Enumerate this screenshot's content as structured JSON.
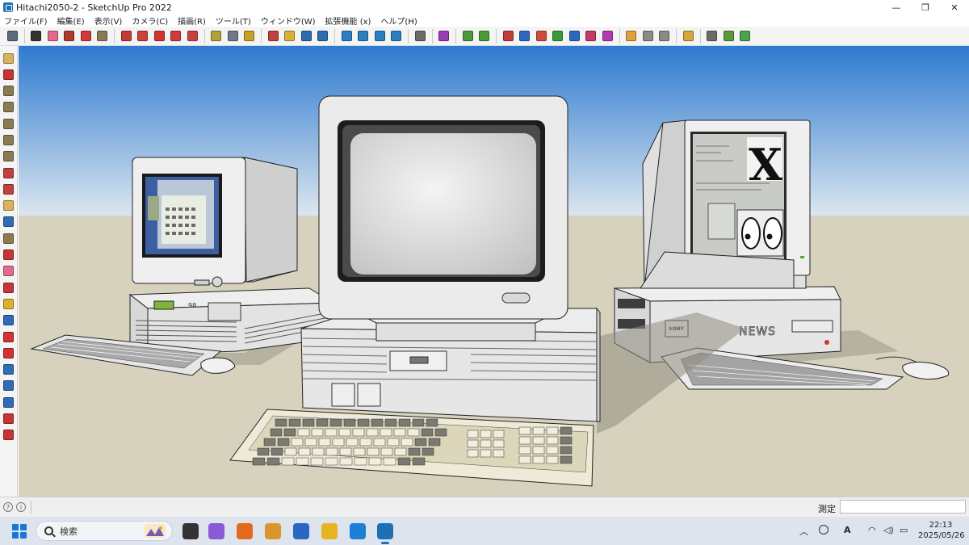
{
  "window": {
    "title": "Hitachi2050-2 - SketchUp Pro 2022",
    "controls": [
      "—",
      "❐",
      "✕"
    ]
  },
  "menu": [
    "ファイル(F)",
    "編集(E)",
    "表示(V)",
    "カメラ(C)",
    "描画(R)",
    "ツール(T)",
    "ウィンドウ(W)",
    "拡張機能 (x)",
    "ヘルプ(H)"
  ],
  "toolbar": {
    "groups": [
      {
        "icons": [
          {
            "name": "zoom-icon",
            "color": "#5a6b7d"
          }
        ]
      },
      {
        "icons": [
          {
            "name": "select-icon",
            "color": "#333333"
          },
          {
            "name": "eraser-icon",
            "color": "#e46a8c"
          },
          {
            "name": "pencil-line-icon",
            "color": "#b0392e"
          },
          {
            "name": "arc-icon",
            "color": "#d3393c"
          },
          {
            "name": "shape-icon",
            "color": "#8b7b52"
          }
        ]
      },
      {
        "icons": [
          {
            "name": "push-pull-icon",
            "color": "#c43a3a"
          },
          {
            "name": "follow-me-icon",
            "color": "#c8433c"
          },
          {
            "name": "move-icon",
            "color": "#d23232"
          },
          {
            "name": "rotate-icon",
            "color": "#d23b3b"
          },
          {
            "name": "scale-icon",
            "color": "#c74343"
          }
        ]
      },
      {
        "icons": [
          {
            "name": "tape-measure-icon",
            "color": "#b0a33a"
          },
          {
            "name": "text-icon",
            "color": "#6f7a86"
          },
          {
            "name": "paint-bucket-icon",
            "color": "#c9a224"
          }
        ]
      },
      {
        "icons": [
          {
            "name": "orbit-icon",
            "color": "#c23f3f"
          },
          {
            "name": "pan-icon",
            "color": "#d8b13c"
          },
          {
            "name": "zoom-tool-icon",
            "color": "#2d6cb0"
          },
          {
            "name": "zoom-extents-icon",
            "color": "#2d6cb0"
          }
        ]
      },
      {
        "icons": [
          {
            "name": "3d-warehouse-icon",
            "color": "#2b7fc2"
          },
          {
            "name": "extension-warehouse-icon",
            "color": "#2b7fc2"
          },
          {
            "name": "layout-icon",
            "color": "#2b7fc2"
          },
          {
            "name": "extension-manager-icon",
            "color": "#2b7fc2"
          }
        ]
      },
      {
        "icons": [
          {
            "name": "account-icon",
            "color": "#6b6b6b"
          }
        ]
      },
      {
        "icons": [
          {
            "name": "style-icon",
            "color": "#9b3ab4"
          }
        ]
      },
      {
        "icons": [
          {
            "name": "sandbox-from-contours-icon",
            "color": "#4a9a3a"
          },
          {
            "name": "sandbox-from-scratch-icon",
            "color": "#4a9a3a"
          }
        ]
      },
      {
        "icons": [
          {
            "name": "outer-shell-icon",
            "color": "#c53b3b"
          },
          {
            "name": "intersect-icon",
            "color": "#2d67c4"
          },
          {
            "name": "union-icon",
            "color": "#d04a3a"
          },
          {
            "name": "subtract-icon",
            "color": "#3a9a3a"
          },
          {
            "name": "trim-icon",
            "color": "#2d67c4"
          },
          {
            "name": "split-icon",
            "color": "#c43a6a"
          },
          {
            "name": "solid-tools-icon",
            "color": "#b43ab4"
          }
        ]
      },
      {
        "icons": [
          {
            "name": "box-orange-icon",
            "color": "#e0a13a"
          },
          {
            "name": "box-white-icon",
            "color": "#8a8a8a"
          },
          {
            "name": "box-shaded-icon",
            "color": "#8a8a8a"
          }
        ]
      },
      {
        "icons": [
          {
            "name": "geo-location-icon",
            "color": "#d9a43a"
          }
        ]
      },
      {
        "icons": [
          {
            "name": "section-plane-icon",
            "color": "#6b6b6b"
          },
          {
            "name": "component-icon",
            "color": "#5a9a3a"
          },
          {
            "name": "recycle-icon",
            "color": "#4aa34a"
          }
        ]
      }
    ]
  },
  "left_toolbar": [
    {
      "name": "select-tool-icon",
      "color": "#d9b25a"
    },
    {
      "name": "line-tool-icon",
      "color": "#c63535"
    },
    {
      "name": "rectangle-tool-icon",
      "color": "#8b7b52"
    },
    {
      "name": "circle-tool-icon",
      "color": "#8b7b52"
    },
    {
      "name": "polygon-tool-icon",
      "color": "#8b7b52"
    },
    {
      "name": "arc-tool-icon",
      "color": "#8b7b52"
    },
    {
      "name": "freehand-tool-icon",
      "color": "#8b7b52"
    },
    {
      "name": "rotated-rect-tool-icon",
      "color": "#c23f3f"
    },
    {
      "name": "offset-tool-icon",
      "color": "#c23f3f"
    },
    {
      "name": "paint-tool-icon",
      "color": "#d9b25a"
    },
    {
      "name": "follow-tool-icon",
      "color": "#2f6cb5"
    },
    {
      "name": "pie-tool-icon",
      "color": "#8b7b52"
    },
    {
      "name": "orbit-tool-icon",
      "color": "#c63535"
    },
    {
      "name": "eraser-tool-icon",
      "color": "#e46a8c"
    },
    {
      "name": "axes-red-icon",
      "color": "#c63535"
    },
    {
      "name": "axes-yellow-icon",
      "color": "#d9b22a"
    },
    {
      "name": "axes-blue-icon",
      "color": "#2f6cb5"
    },
    {
      "name": "move-tool-icon",
      "color": "#d23232"
    },
    {
      "name": "scale-tool-icon",
      "color": "#d23232"
    },
    {
      "name": "tape-tool-icon",
      "color": "#2f6cb5"
    },
    {
      "name": "walk-tool-icon",
      "color": "#2f6cb5"
    },
    {
      "name": "look-around-icon",
      "color": "#2f6cb5"
    },
    {
      "name": "section-tool-icon",
      "color": "#c63535"
    },
    {
      "name": "dimension-tool-icon",
      "color": "#c63535"
    }
  ],
  "scene": {
    "sky_top": "#2e7ad0",
    "sky_bottom": "#dbe6ef",
    "ground": "#d6d2bd",
    "left_pc": {
      "badge": "98",
      "screen_caption": ""
    },
    "right_pc": {
      "brand": "NEWS",
      "maker": "SONY",
      "screen_glyph": "X"
    },
    "center_pc": {}
  },
  "status": {
    "measure_label": "測定",
    "measure_value": ""
  },
  "taskbar": {
    "search_placeholder": "検索",
    "apps": [
      {
        "name": "task-view-icon",
        "color": "#333333"
      },
      {
        "name": "copilot-icon",
        "color": "#8a5ad6"
      },
      {
        "name": "firefox-icon",
        "color": "#e36a1a"
      },
      {
        "name": "photos-icon",
        "color": "#d9962a"
      },
      {
        "name": "mail-icon",
        "color": "#2a66c2"
      },
      {
        "name": "file-explorer-icon",
        "color": "#e6b422"
      },
      {
        "name": "browser-icon",
        "color": "#1e7fd6"
      },
      {
        "name": "sketchup-icon",
        "color": "#1f6fb5"
      }
    ],
    "clock_time": "22:13",
    "clock_date": "2025/05/26"
  }
}
